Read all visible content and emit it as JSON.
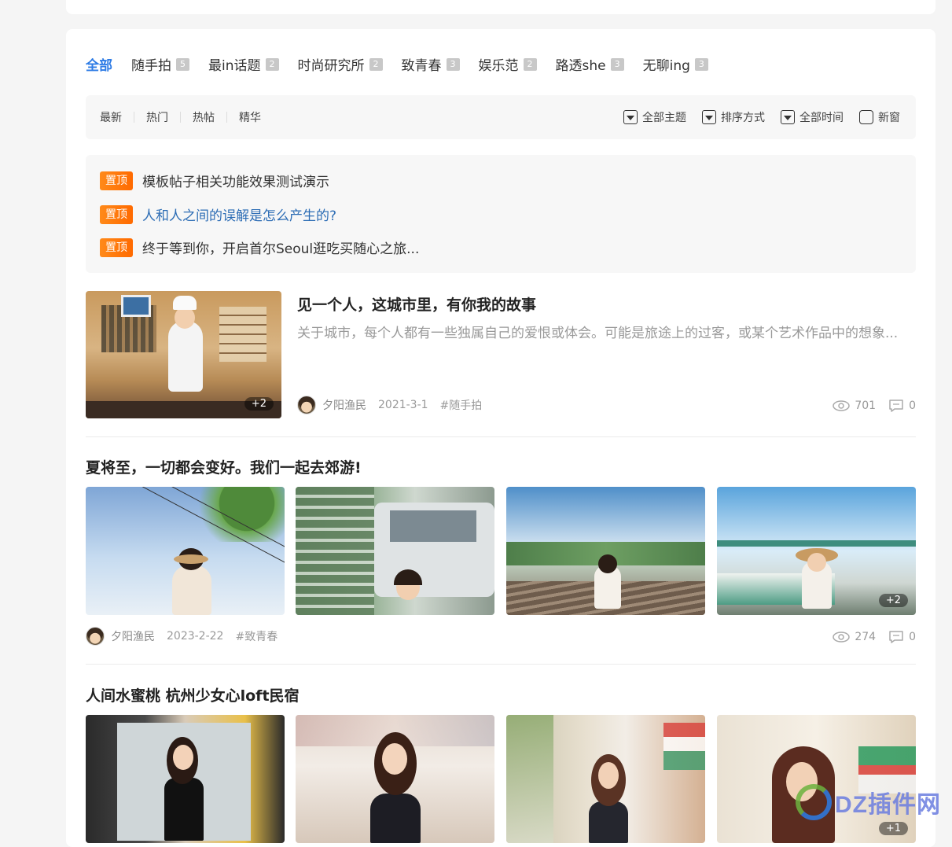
{
  "tabs": [
    {
      "label": "全部",
      "count": ""
    },
    {
      "label": "随手拍",
      "count": "5"
    },
    {
      "label": "最in话题",
      "count": "2"
    },
    {
      "label": "时尚研究所",
      "count": "2"
    },
    {
      "label": "致青春",
      "count": "3"
    },
    {
      "label": "娱乐范",
      "count": "2"
    },
    {
      "label": "路透she",
      "count": "3"
    },
    {
      "label": "无聊ing",
      "count": "3"
    }
  ],
  "sort_links": [
    "最新",
    "热门",
    "热帖",
    "精华"
  ],
  "filters": {
    "topic": "全部主题",
    "order": "排序方式",
    "time": "全部时间",
    "new_window": "新窗"
  },
  "sticky": {
    "badge": "置顶",
    "items": [
      "模板帖子相关功能效果测试演示",
      "人和人之间的误解是怎么产生的?",
      "终于等到你，开启首尔Seoul逛吃买随心之旅..."
    ]
  },
  "posts": [
    {
      "title": "见一个人，这城市里，有你我的故事",
      "desc": "关于城市，每个人都有一些独属自己的爱恨或体会。可能是旅途上的过客，或某个艺术作品中的想象...",
      "author": "夕阳渔民",
      "date": "2021-3-1",
      "tag": "#随手拍",
      "views": "701",
      "comments": "0",
      "more": "+2"
    },
    {
      "title": "夏将至，一切都会变好。我们一起去郊游!",
      "author": "夕阳渔民",
      "date": "2023-2-22",
      "tag": "#致青春",
      "views": "274",
      "comments": "0",
      "more": "+2"
    },
    {
      "title": "人间水蜜桃 杭州少女心loft民宿",
      "more": "+1"
    }
  ],
  "watermark": {
    "text": "DZ插件网"
  }
}
